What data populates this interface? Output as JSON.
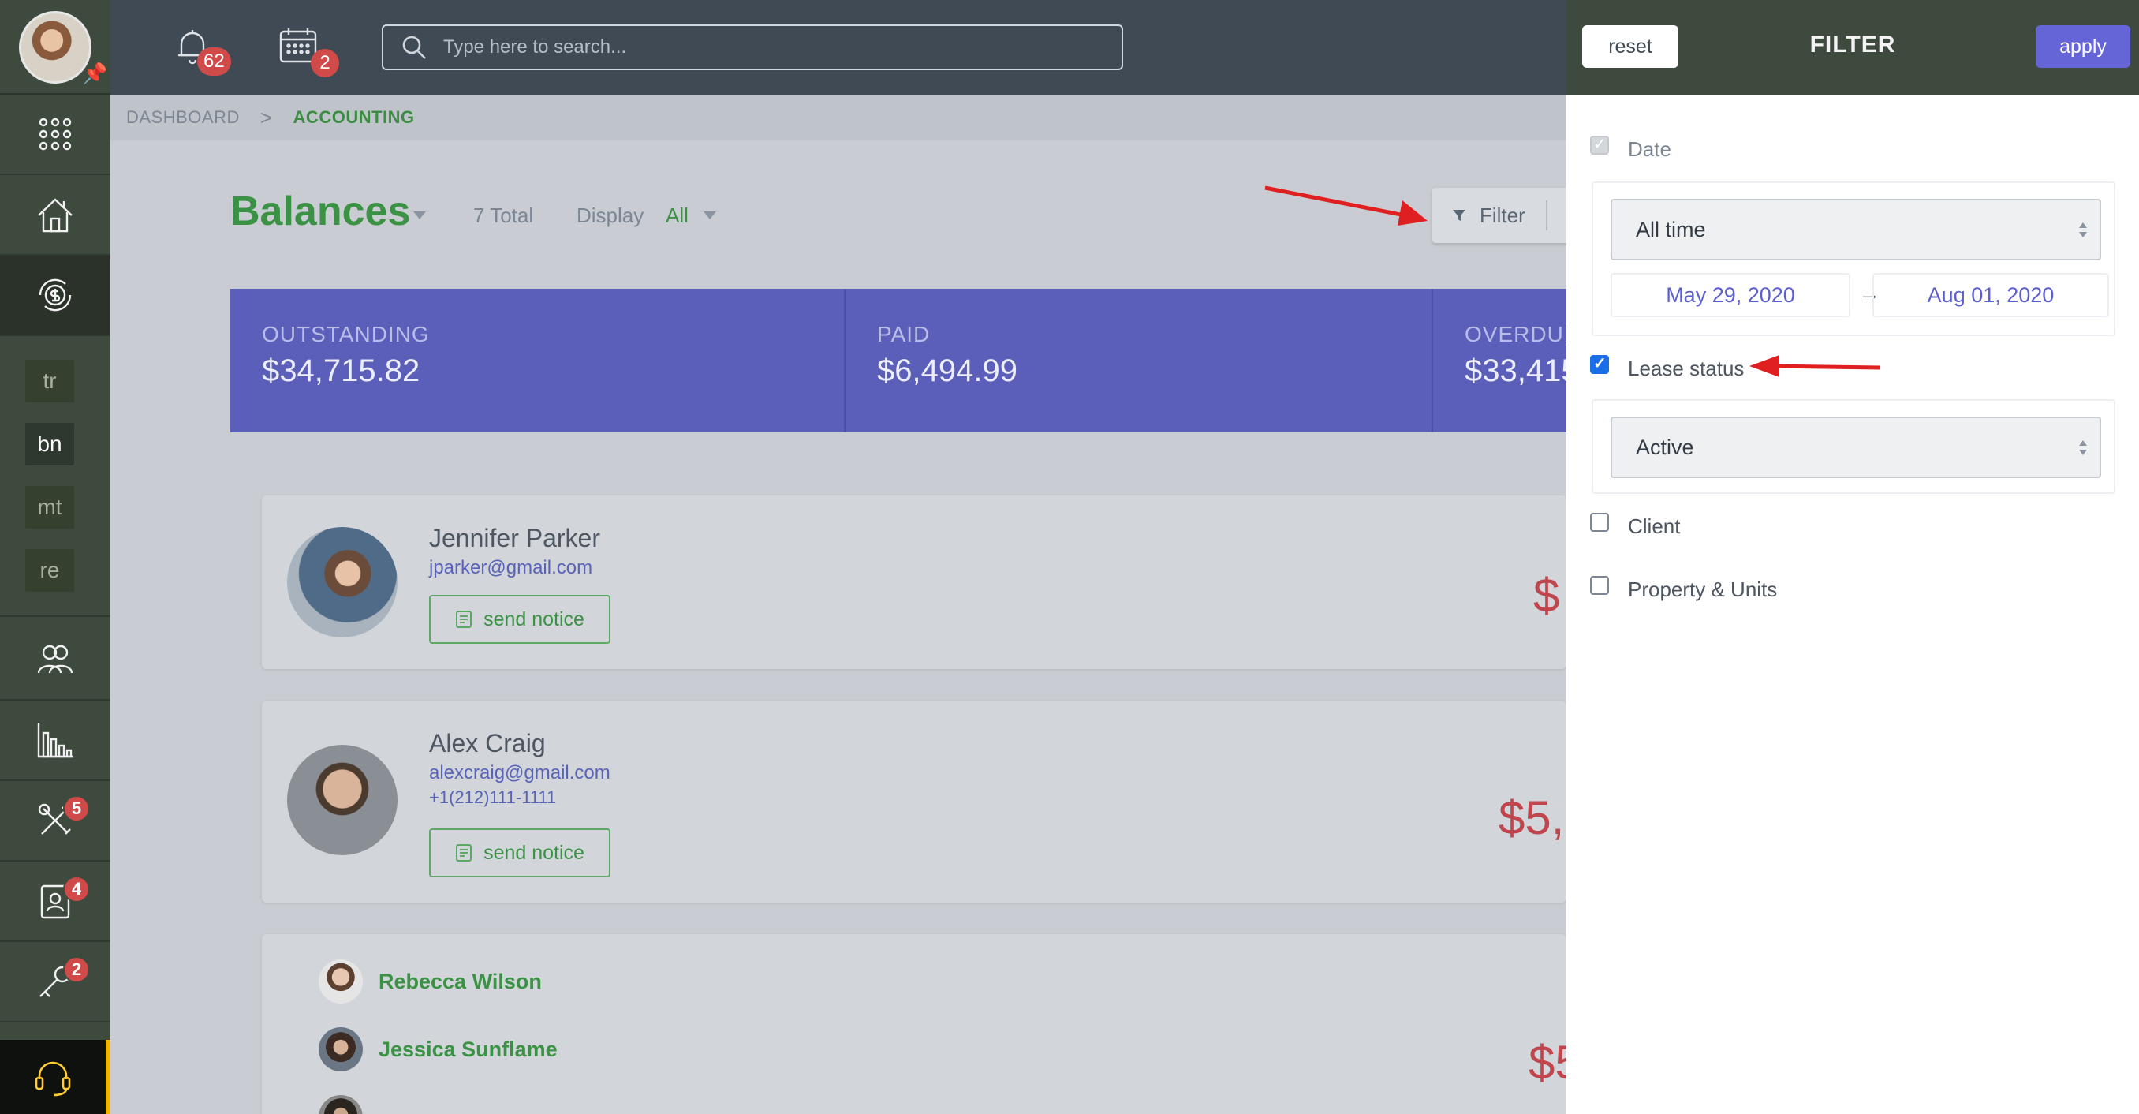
{
  "topbar": {
    "notifications_count": "62",
    "calendar_count": "2",
    "search_placeholder": "Type here to search..."
  },
  "sidebar": {
    "tiles": [
      "tr",
      "bn",
      "mt",
      "re"
    ],
    "badges": {
      "maintenance": "5",
      "contacts": "4",
      "tools": "2"
    }
  },
  "breadcrumb": {
    "root": "DASHBOARD",
    "sep": ">",
    "current": "ACCOUNTING"
  },
  "page": {
    "title": "Balances",
    "total": "7 Total",
    "display_label": "Display",
    "display_value": "All",
    "filter_label": "Filter"
  },
  "summary": [
    {
      "label": "OUTSTANDING",
      "value": "$34,715.82"
    },
    {
      "label": "PAID",
      "value": "$6,494.99"
    },
    {
      "label": "OVERDUE",
      "value": "$33,415"
    }
  ],
  "tenants": [
    {
      "name": "Jennifer Parker",
      "email": "jparker@gmail.com",
      "action": "send notice",
      "amount": "$"
    },
    {
      "name": "Alex Craig",
      "email": "alexcraig@gmail.com",
      "phone": "+1(212)111-1111",
      "action": "send notice",
      "amount": "$5,"
    }
  ],
  "group": {
    "members": [
      "Rebecca Wilson",
      "Jessica Sunflame"
    ],
    "amount": "$5"
  },
  "filter_panel": {
    "reset_label": "reset",
    "title": "FILTER",
    "apply_label": "apply",
    "date_label": "Date",
    "date_range_select": "All time",
    "date_from": "May 29, 2020",
    "date_arrow": "→",
    "date_to": "Aug 01, 2020",
    "lease_label": "Lease status",
    "lease_select": "Active",
    "client_label": "Client",
    "property_label": "Property & Units"
  },
  "colors": {
    "accent_green": "#3b9244",
    "summary_bg": "#5b5fb9",
    "apply_bg": "#6565d8",
    "amount_red": "#c0454c",
    "badge_red": "#d14a4a"
  }
}
